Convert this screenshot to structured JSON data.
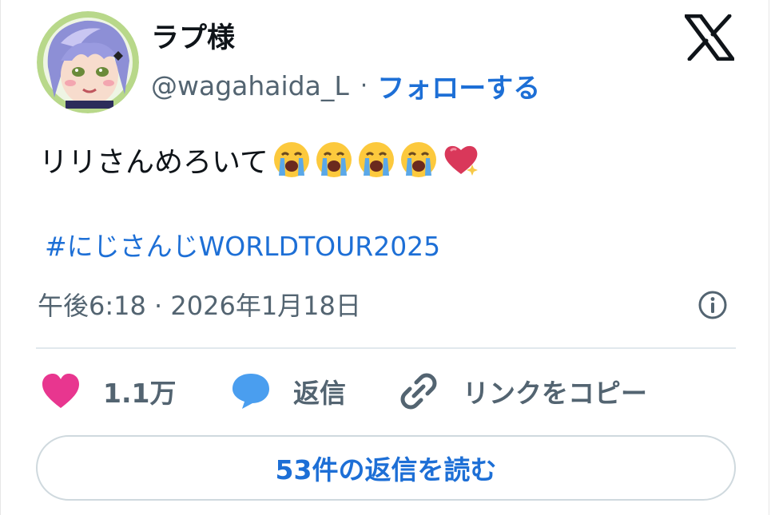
{
  "author": {
    "display_name": "ラプ様",
    "handle": "@wagahaida_L",
    "separator": "·",
    "follow_label": "フォローする"
  },
  "tweet": {
    "text": "リリさんめろいて",
    "emojis": [
      "loudly-crying-face",
      "loudly-crying-face",
      "loudly-crying-face",
      "loudly-crying-face",
      "sparkling-heart"
    ],
    "hashtag": "#にじさんじWORLDTOUR2025",
    "timestamp": "午後6:18 · 2026年1月18日"
  },
  "actions": {
    "likes_count": "1.1万",
    "reply_label": "返信",
    "copy_link_label": "リンクをコピー"
  },
  "read_replies_label": "53件の返信を読む",
  "colors": {
    "link": "#1d6fd6",
    "secondary_text": "#536471",
    "like_heart": "#e8368f",
    "reply_bubble": "#4a9eef",
    "border": "#cfd9de"
  }
}
